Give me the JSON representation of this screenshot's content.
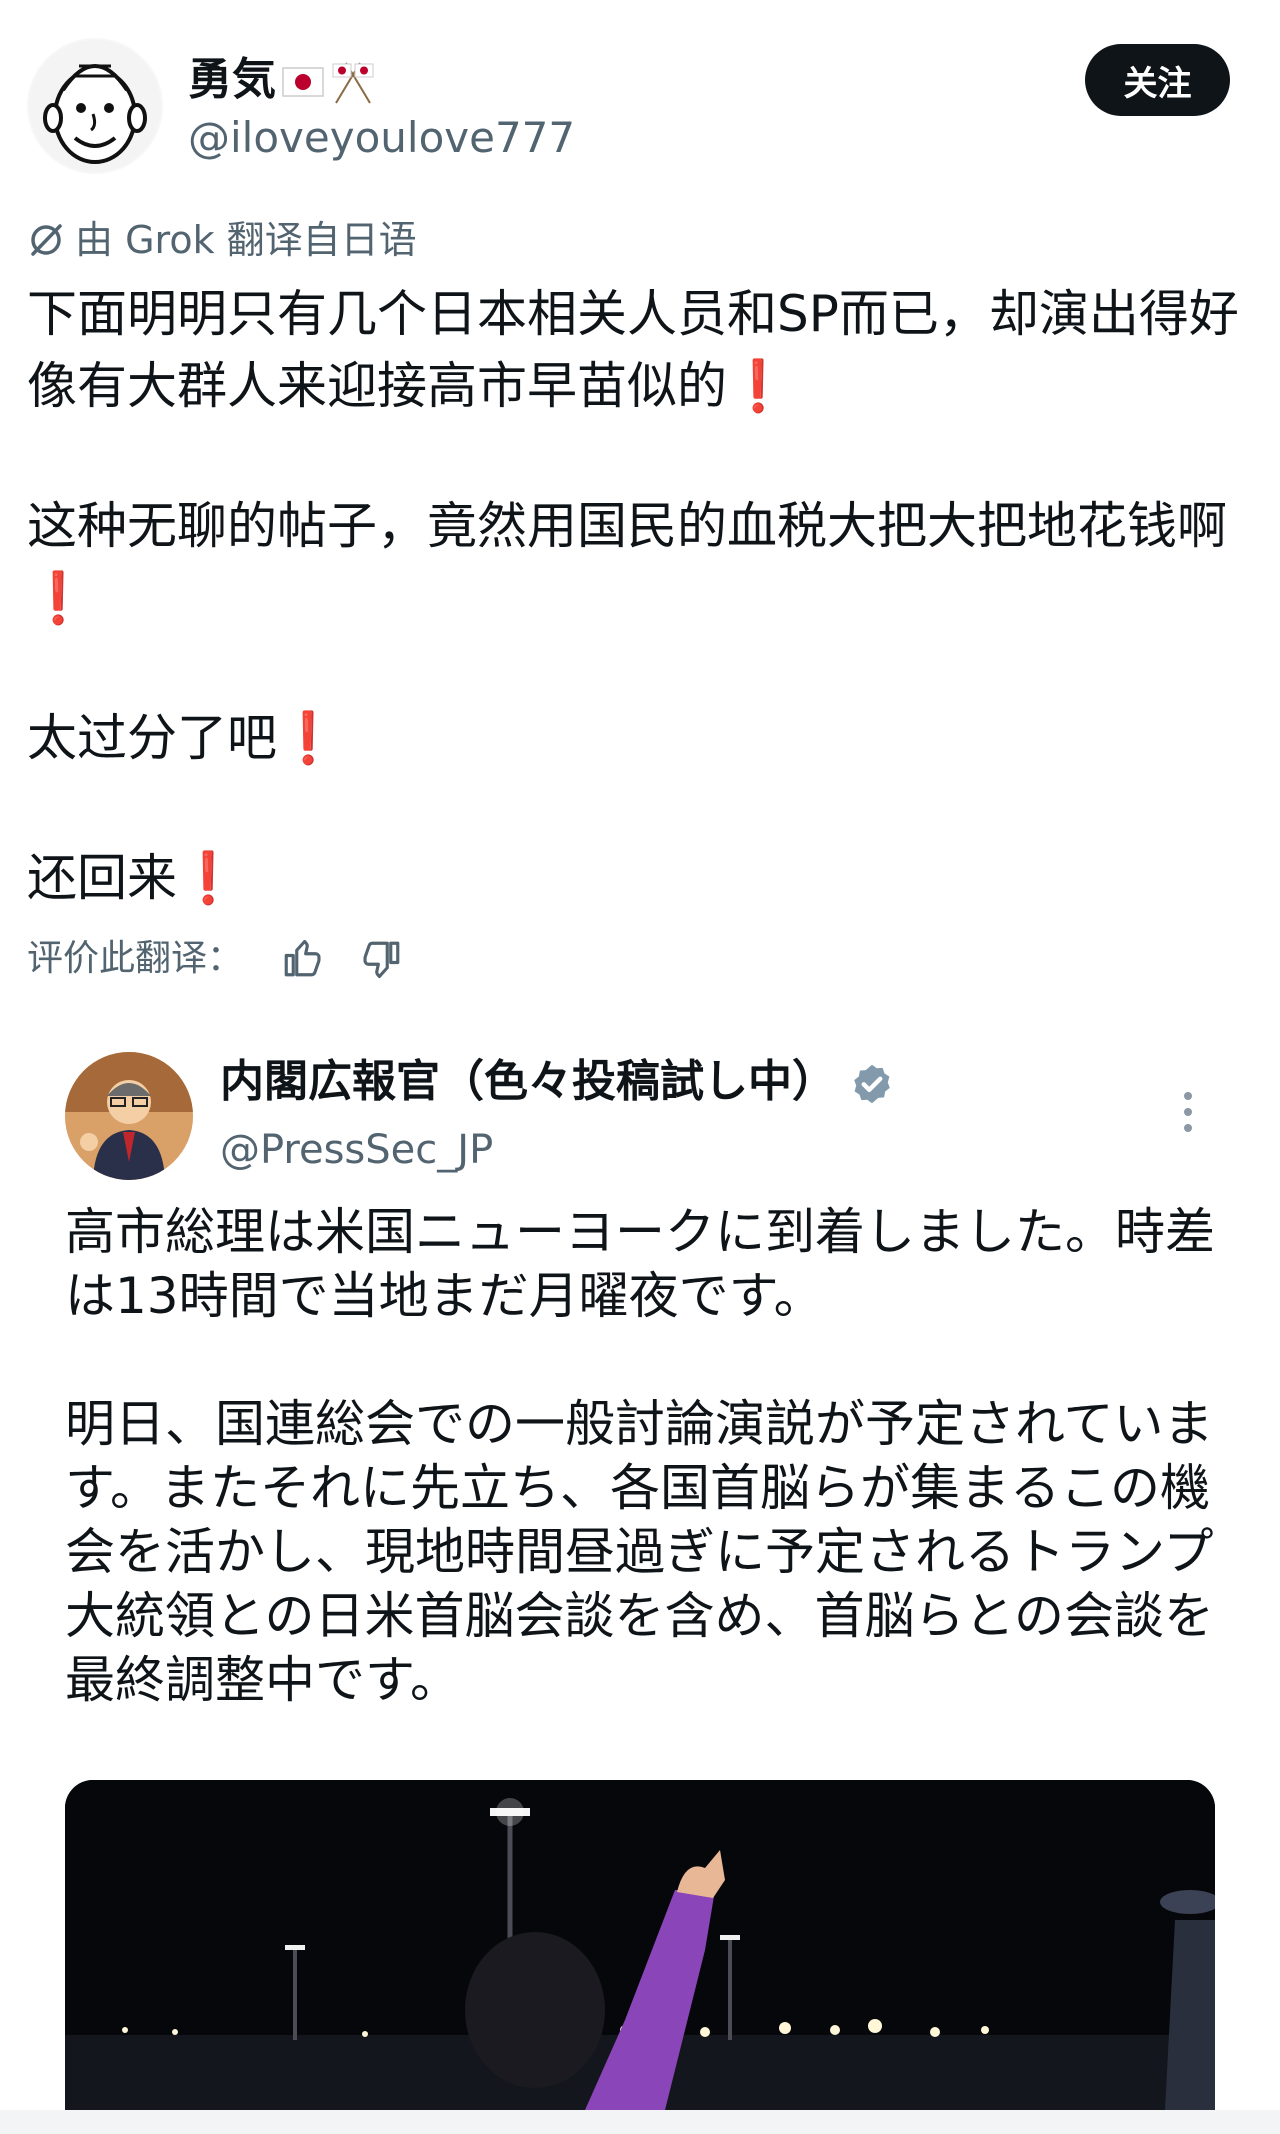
{
  "tweet": {
    "display_name": "勇気",
    "handle": "@iloveyoulove777",
    "follow_label": "关注",
    "translate_label": "由 Grok 翻译自日语",
    "paragraphs": [
      "下面明明只有几个日本相关人员和SP而已，却演出得好像有大群人来迎接高市早苗似的",
      "这种无聊的帖子，竟然用国民的血税大把大把地花钱啊",
      "太过分了吧",
      "还回来"
    ],
    "exclamation": "❗",
    "rate_label": "评价此翻译："
  },
  "quoted": {
    "display_name": "内閣広報官（色々投稿試し中）",
    "handle": "@PressSec_JP",
    "paragraphs": [
      "高市総理は米国ニューヨークに到着しました。時差は13時間で当地まだ月曜夜です。",
      "明日、国連総会での一般討論演説が予定されています。またそれに先立ち、各国首脳らが集まるこの機会を活かし、現地時間昼過ぎに予定されるトランプ大統領との日米首脳会談を含め、首脳らとの会談を最終調整中です。"
    ]
  },
  "colors": {
    "text": "#0f1419",
    "muted": "#536471",
    "accent_exclamation": "#e0142c",
    "verified": "#829aab"
  }
}
